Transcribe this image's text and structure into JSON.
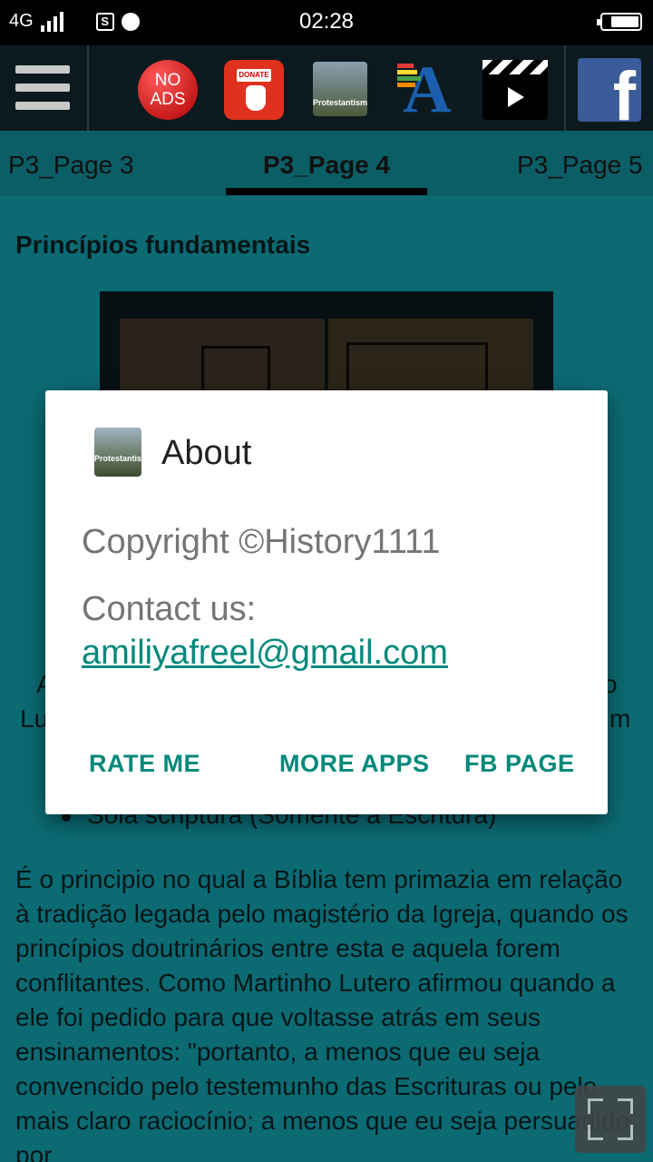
{
  "status_bar": {
    "network": "4G",
    "time": "02:28",
    "sim_icon": "S"
  },
  "toolbar": {
    "icons": [
      "menu-icon",
      "no-ads-icon",
      "donate-icon",
      "protestantism-app-icon",
      "font-size-icon",
      "video-icon",
      "facebook-icon"
    ],
    "no_ads_label": "NO\nADS",
    "donate_tag": "DONATE",
    "app_icon_label": "Protestantism",
    "font_letter": "A",
    "fb_letter": "f"
  },
  "tabs": [
    {
      "label": "P3_Page 3",
      "active": false
    },
    {
      "label": "P3_Page 4",
      "active": true
    },
    {
      "label": "P3_Page 5",
      "active": false
    }
  ],
  "content": {
    "heading": "Princípios fundamentais",
    "fragment_left_1": "A",
    "fragment_right_1": "o",
    "fragment_left_2": "Lu",
    "fragment_right_2": "m",
    "bullet": "Sola scriptura (Somente a Escritura)",
    "paragraph": "É o principio no qual a Bíblia tem primazia em relação à tradição legada pelo magistério da Igreja, quando os princípios doutrinários entre esta e aquela forem conflitantes. Como Martinho Lutero afirmou quando a ele foi pedido para que voltasse atrás em seus ensinamentos: \"portanto, a menos que eu seja convencido pelo testemunho das Escrituras ou pelo mais claro raciocínio; a menos que eu seja persuadido por"
  },
  "dialog": {
    "app_icon_label": "Protestantism",
    "title": "About",
    "copyright": "Copyright ©History1111",
    "contact_label": "Contact us:",
    "email": "amiliyafreel@gmail.com",
    "buttons": {
      "rate": "RATE ME",
      "more_apps": "MORE APPS",
      "fb_page": "FB PAGE"
    }
  },
  "colors": {
    "background_teal": "#0c6a73",
    "accent": "#00897b",
    "toolbar": "#0c1a20"
  }
}
